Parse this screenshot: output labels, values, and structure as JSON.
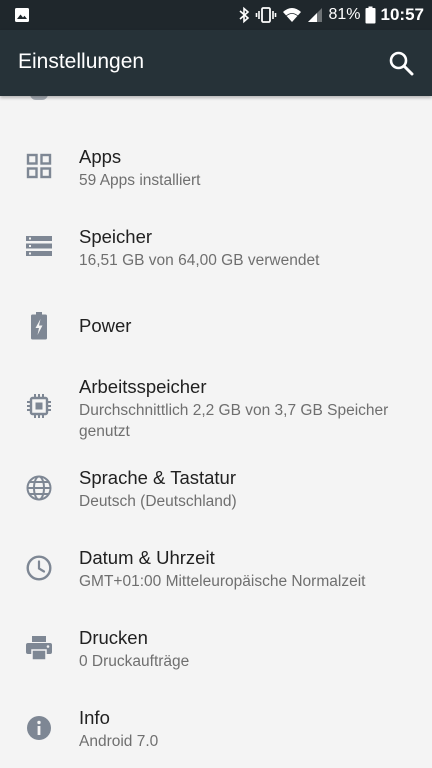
{
  "status_bar": {
    "battery_percent": "81%",
    "time": "10:57",
    "icons": [
      "image-notification-icon",
      "bluetooth-icon",
      "vibrate-icon",
      "wifi-icon",
      "signal-icon",
      "battery-icon"
    ]
  },
  "app_bar": {
    "title": "Einstellungen",
    "search_icon": "search-icon"
  },
  "settings": [
    {
      "label": "Apps",
      "summary": "59 Apps installiert",
      "icon": "apps-grid-icon"
    },
    {
      "label": "Speicher",
      "summary": "16,51 GB von 64,00 GB verwendet",
      "icon": "storage-icon"
    },
    {
      "label": "Power",
      "summary": "",
      "icon": "battery-power-icon"
    },
    {
      "label": "Arbeitsspeicher",
      "summary": "Durchschnittlich 2,2 GB von 3,7 GB Speicher genutzt",
      "icon": "memory-chip-icon"
    },
    {
      "label": "Sprache & Tastatur",
      "summary": "Deutsch (Deutschland)",
      "icon": "globe-icon"
    },
    {
      "label": "Datum & Uhrzeit",
      "summary": "GMT+01:00 Mitteleuropäische Normalzeit",
      "icon": "clock-icon"
    },
    {
      "label": "Drucken",
      "summary": "0 Druckaufträge",
      "icon": "printer-icon"
    },
    {
      "label": "Info",
      "summary": "Android 7.0",
      "icon": "info-icon"
    }
  ],
  "colors": {
    "status_bar": "#1f272c",
    "app_bar": "#263238",
    "background": "#f4f4f4",
    "icon_gray": "#7e8794"
  }
}
